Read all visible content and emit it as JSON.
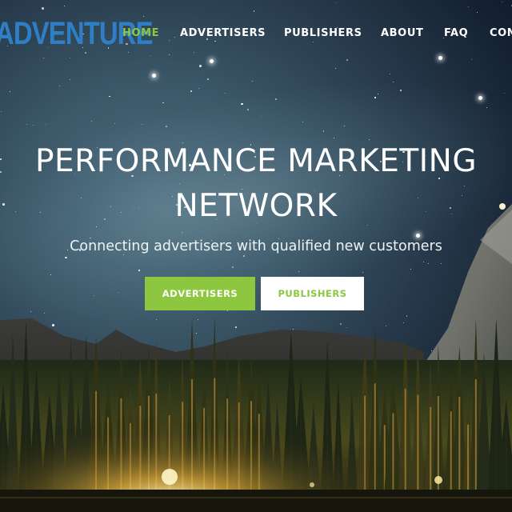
{
  "colors": {
    "accent_green": "#8dc63f",
    "logo_blue": "#2f7fc6",
    "white": "#ffffff"
  },
  "nav": {
    "logo_text": "ADVENTURE",
    "items": [
      {
        "label": "HOME",
        "active": true
      },
      {
        "label": "ADVERTISERS",
        "active": false
      },
      {
        "label": "PUBLISHERS",
        "active": false
      },
      {
        "label": "ABOUT",
        "active": false
      },
      {
        "label": "FAQ",
        "active": false
      },
      {
        "label": "CON",
        "active": false
      }
    ]
  },
  "hero": {
    "title_line1": "PERFORMANCE MARKETING",
    "title_line2": "NETWORK",
    "subtitle": "Connecting advertisers with qualified new customers",
    "cta_advertisers": "ADVERTISERS",
    "cta_publishers": "PUBLISHERS"
  }
}
